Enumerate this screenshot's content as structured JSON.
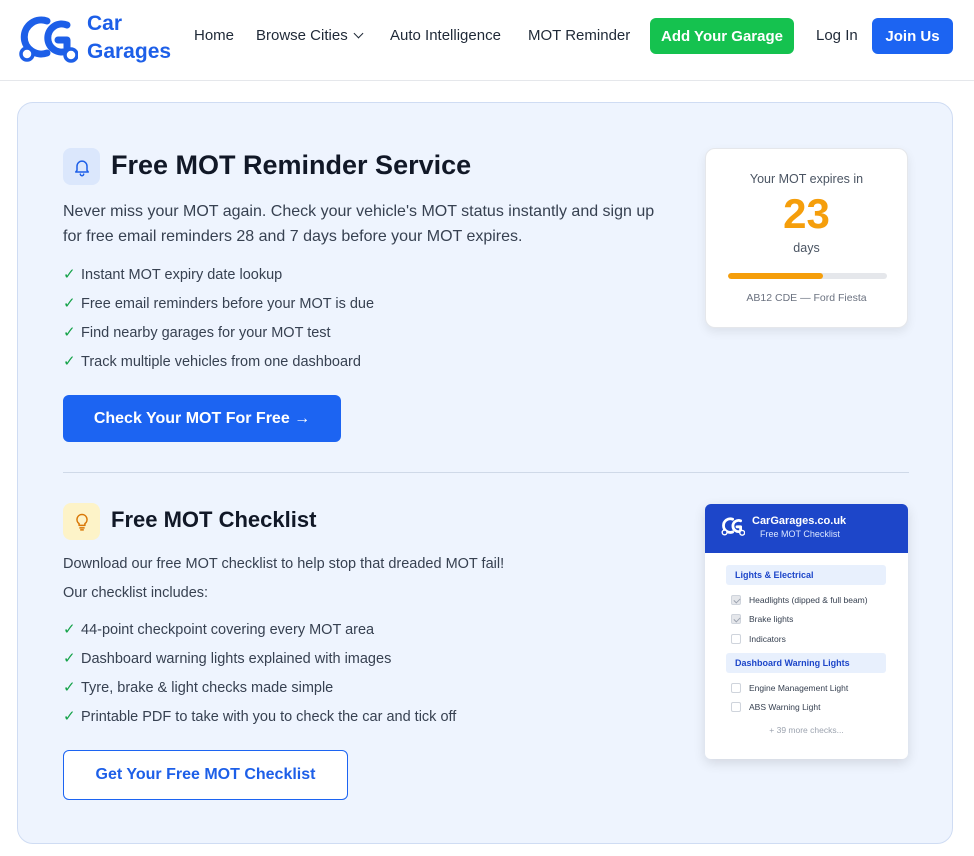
{
  "brand": {
    "line1": "Car",
    "line2": "Garages"
  },
  "nav": {
    "home": "Home",
    "browse_cities": "Browse Cities",
    "auto_intelligence": "Auto Intelligence",
    "mot_reminder": "MOT Reminder",
    "add_garage": "Add Your Garage",
    "login": "Log In",
    "join": "Join Us"
  },
  "reminder": {
    "title": "Free MOT Reminder Service",
    "lead": "Never miss your MOT again. Check your vehicle's MOT status instantly and sign up for free email reminders 28 and 7 days before your MOT expires.",
    "features": [
      "Instant MOT expiry date lookup",
      "Free email reminders before your MOT is due",
      "Find nearby garages for your MOT test",
      "Track multiple vehicles from one dashboard"
    ],
    "cta": "Check Your MOT For Free →"
  },
  "expiry_widget": {
    "label": "Your MOT expires in",
    "days": "23",
    "unit": "days",
    "progress_fraction": 0.6,
    "vehicle": "AB12 CDE — Ford Fiesta"
  },
  "checklist": {
    "title": "Free MOT Checklist",
    "intro": "Download our free MOT checklist to help stop that dreaded MOT fail!",
    "includes": "Our checklist includes:",
    "features": [
      "44-point checkpoint covering every MOT area",
      "Dashboard warning lights explained with images",
      "Tyre, brake & light checks made simple",
      "Printable PDF to take with you to check the car and tick off"
    ],
    "cta": "Get Your Free MOT Checklist"
  },
  "preview": {
    "brand": "CarGarages.co.uk",
    "subtitle": "Free MOT Checklist",
    "category1": "Lights & Electrical",
    "items1": [
      "Headlights (dipped & full beam)",
      "Brake lights",
      "Indicators"
    ],
    "category2": "Dashboard Warning Lights",
    "items2": [
      "Engine Management Light",
      "ABS Warning Light"
    ],
    "more": "+ 39 more checks..."
  },
  "colors": {
    "primary": "#1c64f2",
    "green": "#15c24f",
    "accent": "#f59e0b",
    "check": "#16a34a",
    "card_bg": "#eef4fe"
  },
  "icons": {
    "logo": "car-garages-logo-icon",
    "bell": "bell-icon",
    "bulb": "lightbulb-icon",
    "check": "check-icon",
    "chevron": "chevron-down-icon"
  }
}
